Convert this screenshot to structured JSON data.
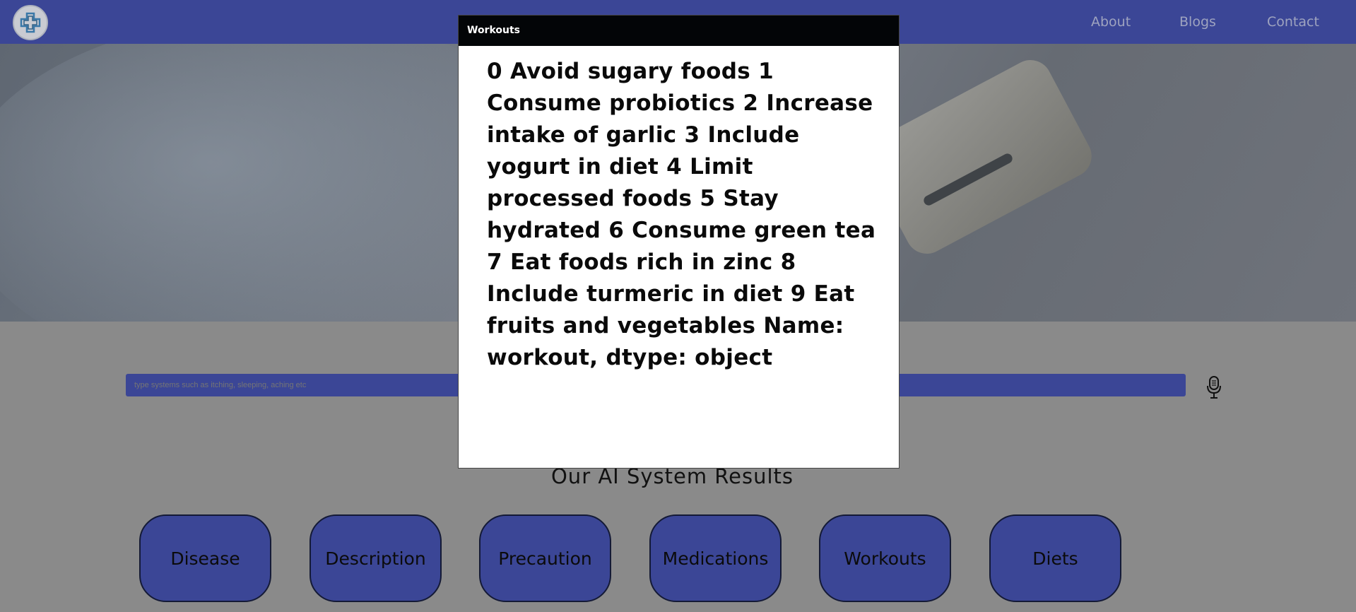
{
  "nav": {
    "links": [
      "About",
      "Blogs",
      "Contact"
    ]
  },
  "search": {
    "placeholder": "type systems such as itching, sleeping, aching etc"
  },
  "results": {
    "title": "Our AI System Results",
    "buttons": [
      "Disease",
      "Description",
      "Precaution",
      "Medications",
      "Workouts",
      "Diets"
    ]
  },
  "modal": {
    "title": "Workouts",
    "body": "0 Avoid sugary foods 1 Consume probiotics 2 Increase intake of garlic 3 Include yogurt in diet 4 Limit processed foods 5 Stay hydrated 6 Consume green tea 7 Eat foods rich in zinc 8 Include turmeric in diet 9 Eat fruits and vegetables Name: workout, dtype: object"
  },
  "colors": {
    "primary": "#3b4696",
    "modal_header": "#030507"
  },
  "icons": {
    "logo": "medical-cross-logo-icon",
    "mic": "microphone-icon"
  }
}
